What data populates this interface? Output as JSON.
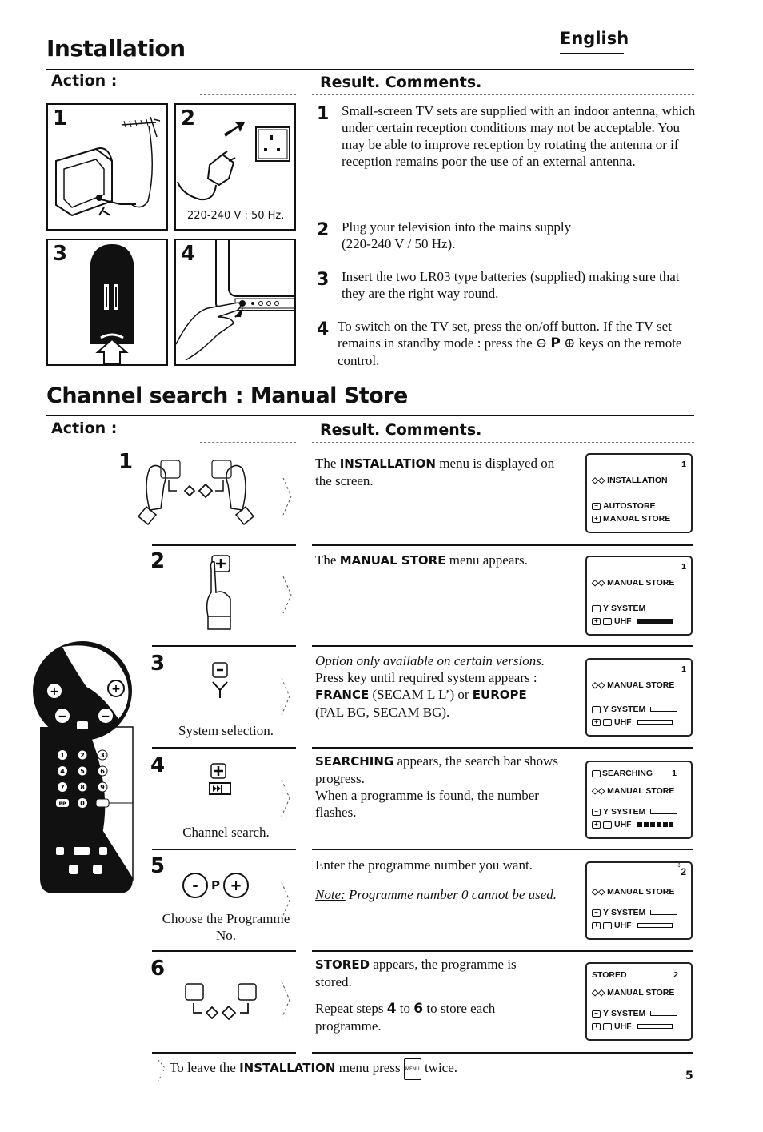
{
  "header": {
    "title": "Installation",
    "language": "English"
  },
  "installation": {
    "action_heading": "Action :",
    "result_heading": "Result. Comments.",
    "panels": [
      {
        "number": "1",
        "icon": "tv-antenna-illustration"
      },
      {
        "number": "2",
        "icon": "plug-socket-illustration",
        "caption": "220-240 V : 50 Hz."
      },
      {
        "number": "3",
        "icon": "remote-batteries-illustration"
      },
      {
        "number": "4",
        "icon": "tv-power-button-illustration"
      }
    ],
    "steps": [
      {
        "number": "1",
        "text": "Small-screen TV sets are supplied with an indoor antenna, which under certain reception conditions may not be acceptable. You may be able to improve reception by rotating the antenna or if reception remains poor the use of an external antenna."
      },
      {
        "number": "2",
        "text": "Plug your television into the mains supply (220-240 V / 50 Hz)."
      },
      {
        "number": "3",
        "text": "Insert the two LR03 type batteries (supplied) making sure that they are the right way round."
      },
      {
        "number": "4",
        "text_before": "To switch on the TV set, press the on/off button. If the TV set remains in standby mode : press the",
        "minus_key": "⊖",
        "p_key": "P",
        "plus_key": "⊕",
        "text_after": "keys on the remote control."
      }
    ]
  },
  "channel_search": {
    "title": "Channel search : Manual Store",
    "action_heading": "Action :",
    "result_heading": "Result. Comments.",
    "steps": [
      {
        "number": "1",
        "caption": "",
        "result": {
          "pre": "The ",
          "bold": "INSTALLATION",
          "post": " menu is displayed on the screen."
        },
        "screen": {
          "top_left": "",
          "top_right": "1",
          "title": "INSTALLATION",
          "line1": "AUTOSTORE",
          "line2": "MANUAL STORE"
        }
      },
      {
        "number": "2",
        "caption": "",
        "result": {
          "pre": "The ",
          "bold": "MANUAL STORE",
          "post": " menu appears."
        },
        "screen": {
          "top_left": "",
          "top_right": "1",
          "title": "MANUAL STORE",
          "line1": "SYSTEM",
          "line2": "UHF",
          "bar": "full"
        }
      },
      {
        "number": "3",
        "caption": "System selection.",
        "result": {
          "italic": "Option only available on certain versions.",
          "line": "Press key until required system appears :",
          "bold1": "FRANCE",
          "mid": " (SECAM L L’) or ",
          "bold2": "EUROPE",
          "end": "(PAL BG, SECAM BG)."
        },
        "screen": {
          "top_left": "",
          "top_right": "1",
          "title": "MANUAL STORE",
          "line1": "SYSTEM",
          "line2": "UHF",
          "bar": "empty"
        }
      },
      {
        "number": "4",
        "caption": "Channel search.",
        "result": {
          "bold": "SEARCHING",
          "post": " appears, the search bar shows progress.",
          "line2": "When a programme is found, the number flashes."
        },
        "screen": {
          "top_left": "SEARCHING",
          "top_right": "1",
          "title": "MANUAL STORE",
          "line1": "SYSTEM",
          "line2": "UHF",
          "bar": "segmented"
        }
      },
      {
        "number": "5",
        "caption": "Choose the Programme No.",
        "keys": {
          "minus": "-",
          "p": "P",
          "plus": "+"
        },
        "result": {
          "line": "Enter the programme number you want.",
          "note_label": "Note:",
          "note": " Programme number 0 cannot be used."
        },
        "screen": {
          "top_left": "",
          "top_right": "2",
          "title": "MANUAL STORE",
          "line1": "SYSTEM",
          "line2": "UHF",
          "bar": "empty",
          "flashing": true
        }
      },
      {
        "number": "6",
        "caption": "",
        "result": {
          "bold": "STORED",
          "post": " appears, the programme is stored.",
          "repeat_pre": "Repeat steps ",
          "from": "4",
          "to_word": " to ",
          "to": "6",
          "repeat_post": " to store each programme."
        },
        "screen": {
          "top_left": "STORED",
          "top_right": "2",
          "title": "MANUAL STORE",
          "line1": "SYSTEM",
          "line2": "UHF",
          "bar": "empty"
        }
      }
    ],
    "footer": {
      "pre": "To leave the ",
      "bold": "INSTALLATION",
      "mid": " menu press ",
      "key": "MENU",
      "post": " twice."
    }
  },
  "remote": {
    "keys": [
      "1",
      "2",
      "3",
      "4",
      "5",
      "6",
      "7",
      "8",
      "9",
      "PP",
      "0"
    ]
  },
  "page_number": "5"
}
